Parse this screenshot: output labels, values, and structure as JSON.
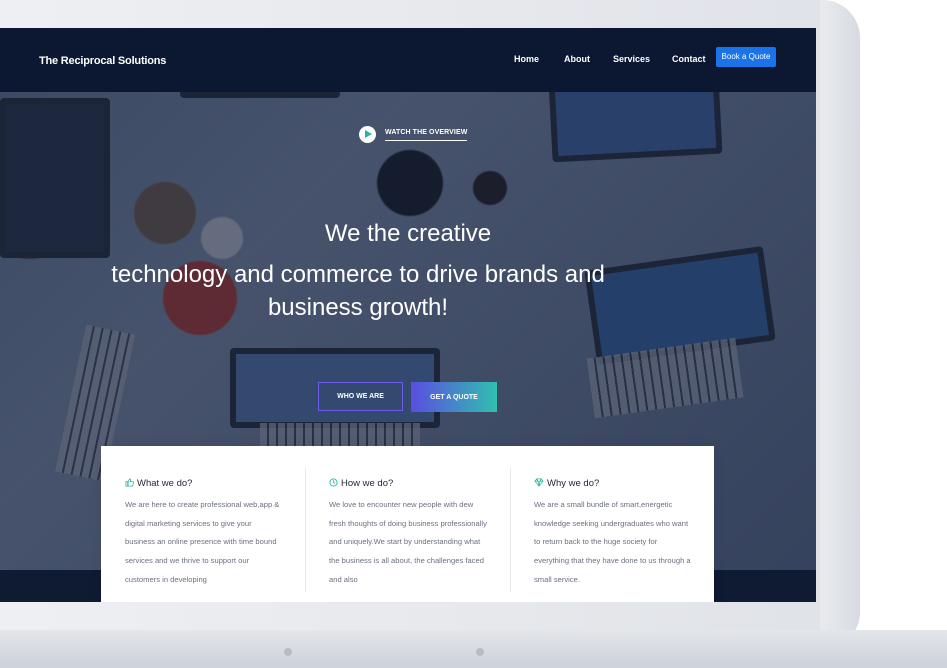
{
  "nav": {
    "brand": "The Reciprocal Solutions",
    "links": [
      "Home",
      "About",
      "Services",
      "Contact"
    ],
    "cta": "Book a Quote"
  },
  "hero": {
    "overview_label": "WATCH THE OVERVIEW",
    "headline_line1": "We the creative",
    "headline_line2": "technology and commerce to drive brands and business growth!",
    "btn_who": "WHO WE ARE",
    "btn_get": "GET A QUOTE"
  },
  "features": [
    {
      "icon": "thumbs-up-icon",
      "title": "What we do?",
      "text": "We are here to create professional web,app & digital marketing services to give your business an online presence with time bound services and we thrive to support our customers in developing"
    },
    {
      "icon": "clock-icon",
      "title": "How we do?",
      "text": "We love to encounter new people with dew fresh thoughts of doing business professionally and uniquely.We start by understanding what the business is all about, the challenges faced and also"
    },
    {
      "icon": "diamond-icon",
      "title": "Why we do?",
      "text": "We are a small bundle of smart,energetic knowledge seeking undergraduates who want to return back to the huge society for everything that they have done to us through a small service."
    }
  ],
  "colors": {
    "navbar": "#0c1731",
    "cta": "#1a73e8",
    "gradient_start": "#5b4de0",
    "gradient_end": "#2fc0b0"
  }
}
